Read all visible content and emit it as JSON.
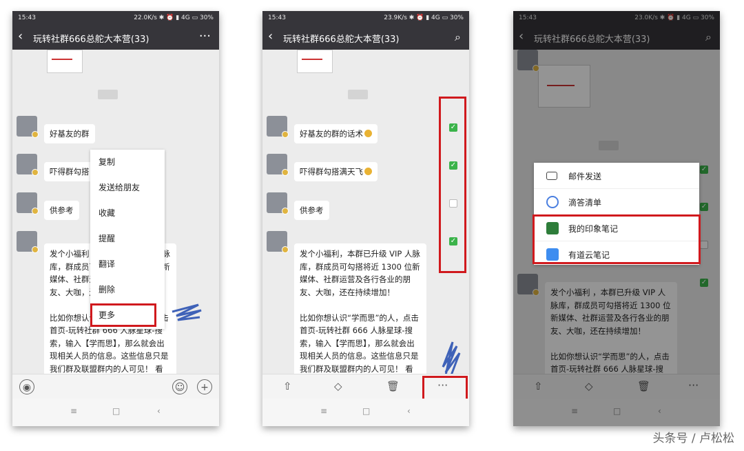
{
  "status": {
    "time": "15:43",
    "p1_speed": "22.0K/s",
    "p2_speed": "23.9K/s",
    "p3_speed": "23.0K/s",
    "network": "4G",
    "battery": "30%"
  },
  "chat_title": "玩转社群666总舵大本营(33)",
  "chat_title_p1": "玩转社群666总舵大本营(33)",
  "messages": [
    {
      "text": "好基友的群的话术"
    },
    {
      "text": "吓得群勾搭满天飞"
    },
    {
      "text": "供参考"
    },
    {
      "text_p1": "发个小福利 本群已升级 VIP 人脉库，群成员可勾搭将近 1300 位新媒体、社群运营及各行各业的朋友、大咖，还在持续增加！",
      "text_full": "发个小福利，本群已升级 VIP 人脉库，群成员可勾搭将近 1300 位新媒体、社群运营及各行各业的朋友、大咖，还在持续增加！",
      "text2": "比如你想认识“学而思”的人，点击首页-玩转社群 666 人脉星球-搜索，输入【学而思】，那么就会出现相关人员的信息。这些信息只是我们群及联盟群内的人可见！ 看上谁了，我帮你牵线！"
    }
  ],
  "p1_bubbles": [
    "好基友的群",
    "吓得群勾搭",
    "供参考"
  ],
  "p1_long": "发个小福利 群 人脉库，群成 新媒体、社 友、大咖，",
  "p1_long2": "比如你想认识“学而思”的人，点击首页-玩转社群 666 人脉星球-搜索，输入【学而思】，那么就会出现相关人员的信息。这些信息只是我们群及联盟群内的人可见！ 看上谁了，我帮你牵线！",
  "context_menu": [
    "复制",
    "发送给朋友",
    "收藏",
    "提醒",
    "翻译",
    "删除",
    "更多"
  ],
  "share_menu": [
    "邮件发送",
    "滴答清单",
    "我的印象笔记",
    "有道云笔记"
  ],
  "p3_long": "发个小福利 ，本群已升级 VIP 人脉库，群成员可勾搭将近 1300 位新媒体、社群运营及各行各业的朋友、大咖，还在持续增加！",
  "p3_long2": "比如你想认识“学而思”的人，点击首页-玩转社群 666 人脉星球-搜",
  "watermark": "头条号 / 卢松松",
  "colors": {
    "accent_green": "#3bb34a",
    "highlight_red": "#d0191d",
    "titlebar": "#36353a"
  }
}
